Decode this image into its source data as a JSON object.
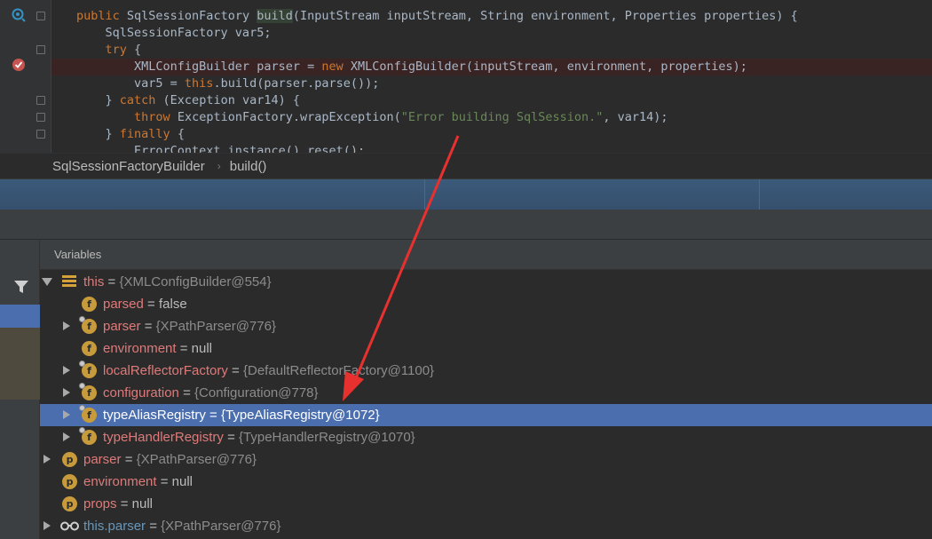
{
  "editor": {
    "lines": [
      {
        "segments": [
          {
            "t": "public ",
            "c": "kw"
          },
          {
            "t": "SqlSessionFactory ",
            "c": ""
          },
          {
            "t": "build",
            "c": "hl"
          },
          {
            "t": "(InputStream inputStream, String environment, Properties properties) {",
            "c": ""
          }
        ]
      },
      {
        "segments": [
          {
            "t": "    SqlSessionFactory var5;",
            "c": ""
          }
        ]
      },
      {
        "segments": [
          {
            "t": "    ",
            "c": ""
          },
          {
            "t": "try",
            "c": "kw"
          },
          {
            "t": " {",
            "c": ""
          }
        ]
      },
      {
        "segments": [
          {
            "t": "        XMLConfigBuilder parser = ",
            "c": ""
          },
          {
            "t": "new ",
            "c": "kw"
          },
          {
            "t": "XMLConfigBuilder(inputStream, environment, properties);",
            "c": ""
          }
        ]
      },
      {
        "segments": [
          {
            "t": "        var5 = ",
            "c": ""
          },
          {
            "t": "this",
            "c": "kw"
          },
          {
            "t": ".build(parser.parse());",
            "c": ""
          }
        ]
      },
      {
        "segments": [
          {
            "t": "    } ",
            "c": ""
          },
          {
            "t": "catch",
            "c": "kw"
          },
          {
            "t": " (Exception var14) {",
            "c": ""
          }
        ]
      },
      {
        "segments": [
          {
            "t": "        ",
            "c": ""
          },
          {
            "t": "throw ",
            "c": "kw"
          },
          {
            "t": "ExceptionFactory.wrapException(",
            "c": ""
          },
          {
            "t": "\"Error building SqlSession.\"",
            "c": "str"
          },
          {
            "t": ", var14);",
            "c": ""
          }
        ]
      },
      {
        "segments": [
          {
            "t": "    } ",
            "c": ""
          },
          {
            "t": "finally",
            "c": "kw"
          },
          {
            "t": " {",
            "c": ""
          }
        ]
      },
      {
        "segments": [
          {
            "t": "        ErrorContext.instance().reset();",
            "c": ""
          }
        ]
      }
    ],
    "breakpoint_line": 3
  },
  "breadcrumb": {
    "class_name": "SqlSessionFactoryBuilder",
    "separator": "›",
    "method": "build()"
  },
  "variables_panel": {
    "title": "Variables",
    "rows": [
      {
        "level": 0,
        "expander": "down",
        "icon": "object-icon",
        "name": "this",
        "name_color": "red",
        "eq": " = ",
        "value": "{XMLConfigBuilder@554}",
        "value_style": "gray",
        "selected": false
      },
      {
        "level": 1,
        "expander": "none",
        "icon": "field-icon",
        "locked": false,
        "name": "parsed",
        "name_color": "red",
        "eq": " = ",
        "value": "false",
        "value_style": "plain",
        "selected": false
      },
      {
        "level": 1,
        "expander": "right",
        "icon": "field-icon",
        "locked": true,
        "name": "parser",
        "name_color": "red",
        "eq": " = ",
        "value": "{XPathParser@776}",
        "value_style": "gray",
        "selected": false
      },
      {
        "level": 1,
        "expander": "none",
        "icon": "field-icon",
        "locked": false,
        "name": "environment",
        "name_color": "red",
        "eq": " = ",
        "value": "null",
        "value_style": "plain",
        "selected": false
      },
      {
        "level": 1,
        "expander": "right",
        "icon": "field-icon",
        "locked": true,
        "name": "localReflectorFactory",
        "name_color": "red",
        "eq": " = ",
        "value": "{DefaultReflectorFactory@1100}",
        "value_style": "gray",
        "selected": false
      },
      {
        "level": 1,
        "expander": "right",
        "icon": "field-icon",
        "locked": true,
        "name": "configuration",
        "name_color": "red",
        "eq": " = ",
        "value": "{Configuration@778}",
        "value_style": "gray",
        "selected": false
      },
      {
        "level": 1,
        "expander": "right",
        "icon": "field-icon",
        "locked": true,
        "name": "typeAliasRegistry",
        "name_color": "red",
        "eq": " = ",
        "value": "{TypeAliasRegistry@1072}",
        "value_style": "gray",
        "selected": true
      },
      {
        "level": 1,
        "expander": "right",
        "icon": "field-icon",
        "locked": true,
        "name": "typeHandlerRegistry",
        "name_color": "red",
        "eq": " = ",
        "value": "{TypeHandlerRegistry@1070}",
        "value_style": "gray",
        "selected": false
      },
      {
        "level": 0,
        "expander": "right",
        "icon": "param-icon",
        "name": "parser",
        "name_color": "red",
        "eq": " = ",
        "value": "{XPathParser@776}",
        "value_style": "gray",
        "selected": false
      },
      {
        "level": 0,
        "expander": "none",
        "icon": "param-icon",
        "name": "environment",
        "name_color": "red",
        "eq": " = ",
        "value": "null",
        "value_style": "plain",
        "selected": false
      },
      {
        "level": 0,
        "expander": "none",
        "icon": "param-icon",
        "name": "props",
        "name_color": "red",
        "eq": " = ",
        "value": "null",
        "value_style": "plain",
        "selected": false
      },
      {
        "level": 0,
        "expander": "right",
        "icon": "watch-icon",
        "name": "this.parser",
        "name_color": "blue",
        "eq": " = ",
        "value": "{XPathParser@776}",
        "value_style": "gray",
        "selected": false
      }
    ]
  },
  "colors": {
    "annotation_arrow": "#e8312f",
    "selection": "#4b6eaf",
    "field_icon": "#c79b3b"
  }
}
